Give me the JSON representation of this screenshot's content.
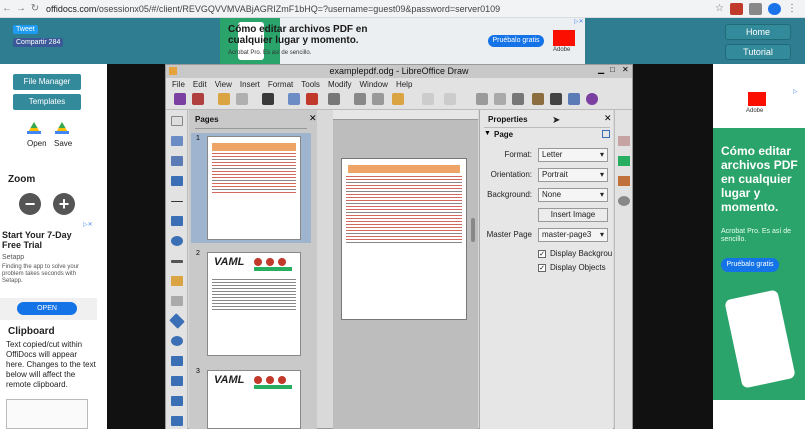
{
  "browser": {
    "url_prefix": "offidocs.com",
    "url_rest": "/osessionx05/#/client/REVGQVVMVABjAGRIZmF1bHQ=?username=guest09&password=server0109"
  },
  "header": {
    "tweet_label": "Tweet",
    "share_label": "Compartir 284",
    "home_label": "Home",
    "tutorial_label": "Tutorial"
  },
  "top_ad": {
    "headline": "Cómo editar archivos PDF en cualquier lugar y momento.",
    "subtext": "Acrobat Pro. Es así de sencillo.",
    "button": "Pruébalo gratis",
    "brand": "Adobe"
  },
  "left": {
    "file_manager": "File Manager",
    "templates": "Templates",
    "open": "Open",
    "save": "Save",
    "zoom": "Zoom",
    "zoom_out": "−",
    "zoom_in": "+",
    "ad_title": "Start Your 7-Day Free Trial",
    "ad_brand": "Setapp",
    "ad_body": "Finding the app to solve your problem takes seconds with Setapp.",
    "ad_button": "OPEN",
    "clipboard_title": "Clipboard",
    "clipboard_body": "Text copied/cut within OffiDocs will appear here. Changes to the text below will affect the remote clipboard."
  },
  "app": {
    "title": "examplepdf.odg - LibreOffice Draw",
    "menu": [
      "File",
      "Edit",
      "View",
      "Insert",
      "Format",
      "Tools",
      "Modify",
      "Window",
      "Help"
    ],
    "pages_title": "Pages",
    "page_nums": [
      "1",
      "2",
      "3"
    ],
    "thumb_title": "VAML",
    "properties_title": "Properties",
    "page_section": "Page",
    "format_label": "Format:",
    "format_value": "Letter",
    "orientation_label": "Orientation:",
    "orientation_value": "Portrait",
    "background_label": "Background:",
    "background_value": "None",
    "insert_image": "Insert Image",
    "master_label": "Master Page",
    "master_value": "master-page3",
    "display_background": "Display Backgrounds",
    "display_objects": "Display Objects",
    "check_mark": "✓"
  },
  "right_ad": {
    "brand": "Adobe",
    "headline": "Cómo editar archivos PDF en cualquier lugar y momento.",
    "subtext": "Acrobat Pro. Es así de sencillo.",
    "button": "Pruébalo gratis"
  }
}
